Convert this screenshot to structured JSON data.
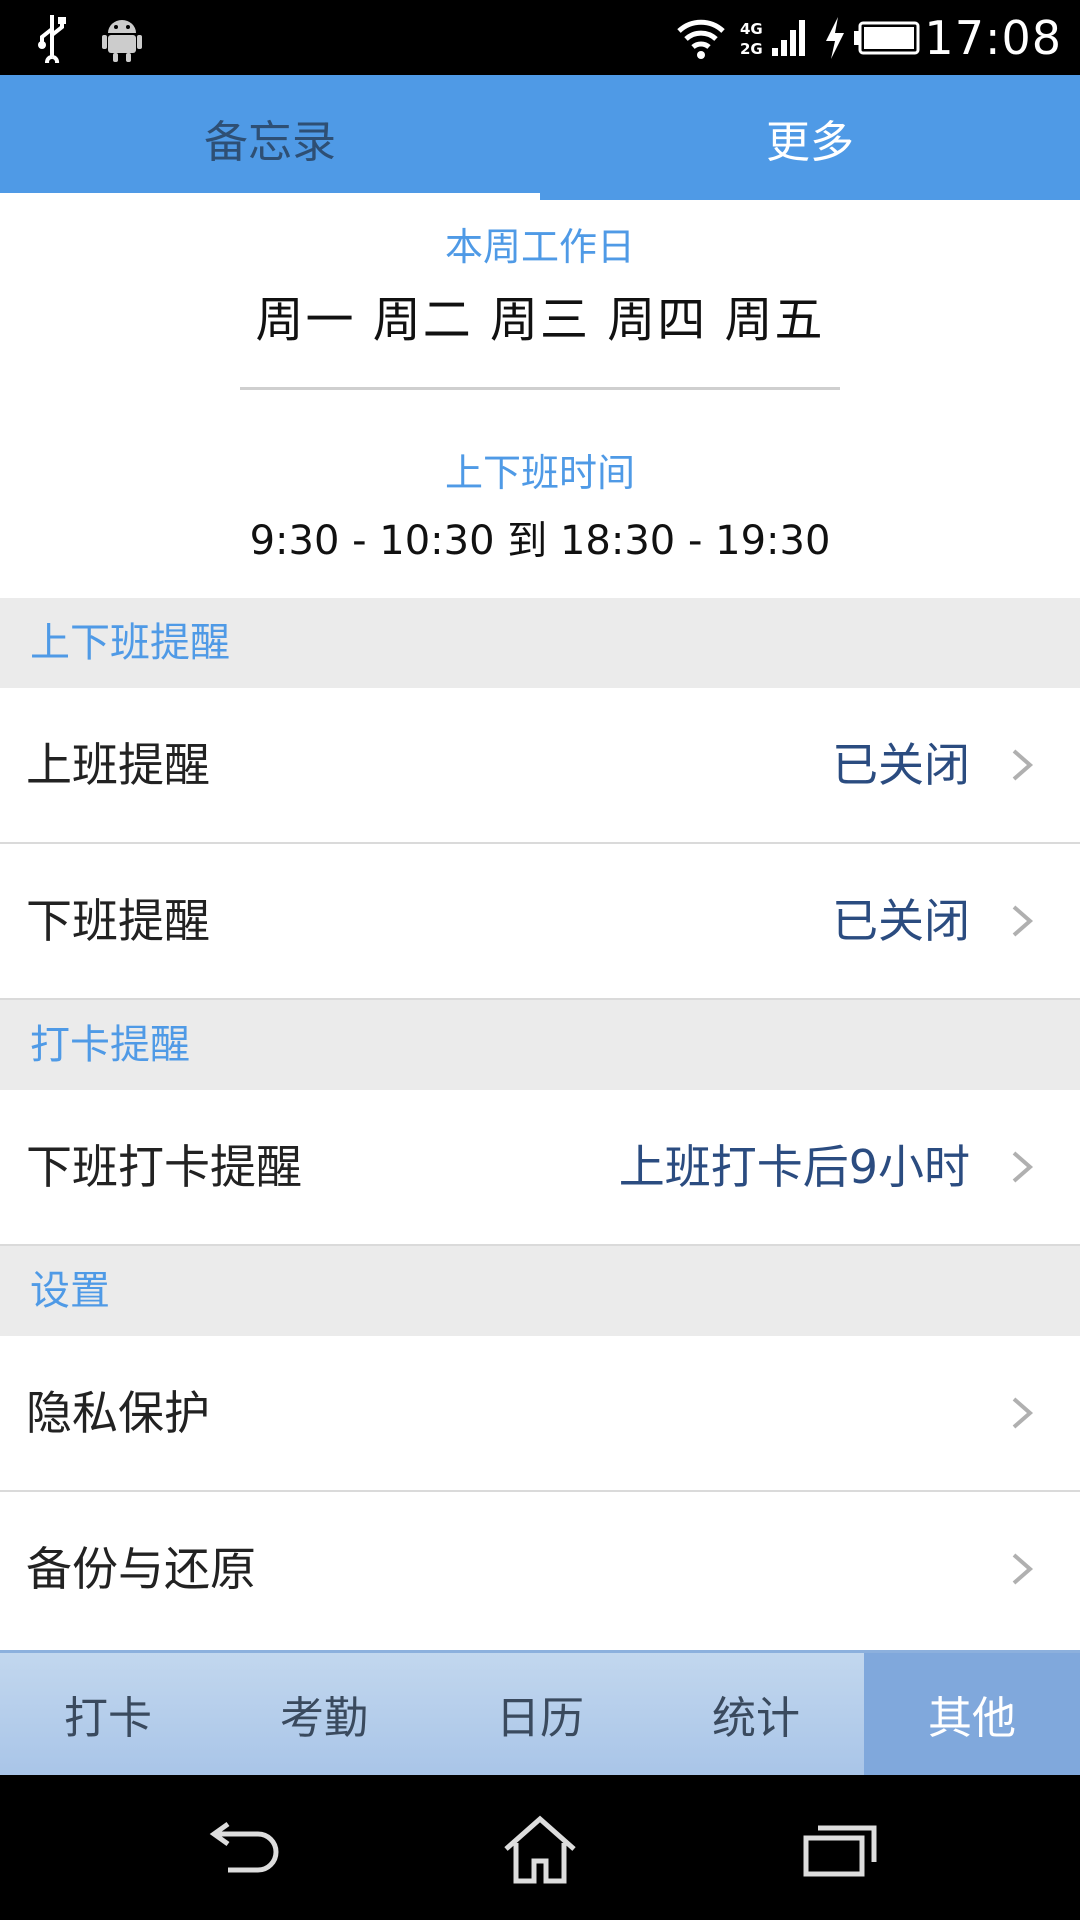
{
  "status_bar": {
    "time": "17:08",
    "network_top": "4G",
    "network_bottom": "2G",
    "icons": [
      "usb-icon",
      "android-icon",
      "wifi-icon",
      "signal-icon",
      "charging-icon",
      "battery-icon"
    ]
  },
  "top_tabs": [
    {
      "label": "备忘录",
      "active": false
    },
    {
      "label": "更多",
      "active": true
    }
  ],
  "info": {
    "workdays_label": "本周工作日",
    "workdays_value": "周一 周二 周三 周四 周五",
    "hours_label": "上下班时间",
    "hours_value": "9:30 - 10:30 到 18:30 - 19:30"
  },
  "sections": {
    "commute": {
      "header": "上下班提醒",
      "items": [
        {
          "label": "上班提醒",
          "value": "已关闭"
        },
        {
          "label": "下班提醒",
          "value": "已关闭"
        }
      ]
    },
    "punch": {
      "header": "打卡提醒",
      "items": [
        {
          "label": "下班打卡提醒",
          "value": "上班打卡后9小时"
        }
      ]
    },
    "settings": {
      "header": "设置",
      "items": [
        {
          "label": "隐私保护",
          "value": ""
        },
        {
          "label": "备份与还原",
          "value": ""
        }
      ]
    }
  },
  "bottom_nav": [
    {
      "label": "打卡",
      "active": false
    },
    {
      "label": "考勤",
      "active": false
    },
    {
      "label": "日历",
      "active": false
    },
    {
      "label": "统计",
      "active": false
    },
    {
      "label": "其他",
      "active": true
    }
  ],
  "colors": {
    "accent": "#4f9ae6",
    "value_text": "#2b4c80",
    "section_bg": "#ebebeb",
    "nav_active": "#80a8dc"
  }
}
